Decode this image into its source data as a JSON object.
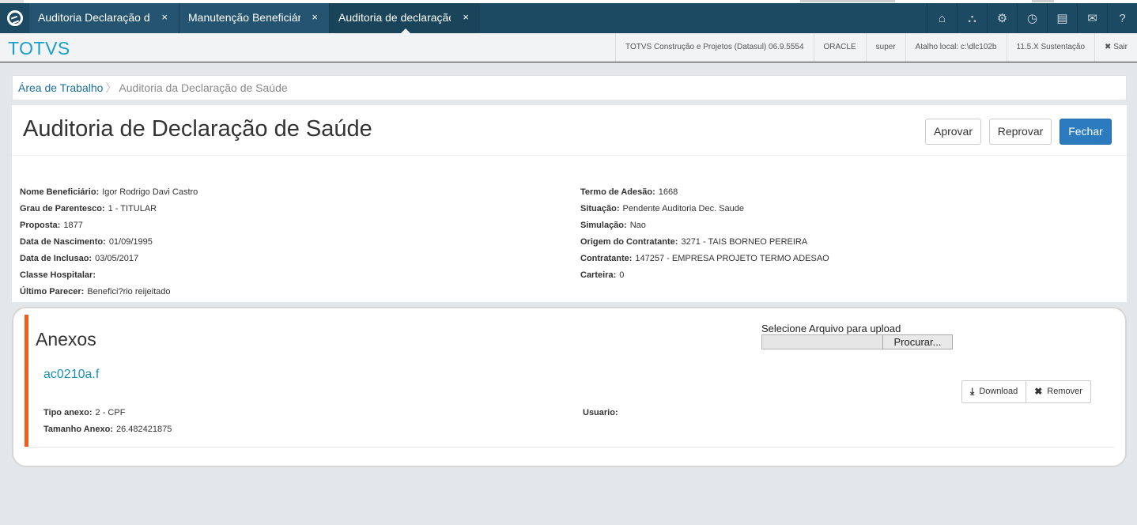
{
  "tabs": [
    {
      "label": "Auditoria Declaração de Saúde",
      "close": "×"
    },
    {
      "label": "Manutenção Beneficiário",
      "close": "×"
    },
    {
      "label": "Auditoria de declaração",
      "close": "×"
    }
  ],
  "topicons": [
    "home-icon",
    "sitemap-icon",
    "gear-icon",
    "clock-icon",
    "document-icon",
    "mail-icon",
    "help-icon"
  ],
  "topicon_glyphs": [
    "⌂",
    "⛬",
    "⚙",
    "◷",
    "▤",
    "✉",
    "?"
  ],
  "header": {
    "brand": "TOTVS",
    "company": "TOTVS Construção e Projetos (Datasul) 06.9.5554",
    "db": "ORACLE",
    "user": "super",
    "shortcut": "Atalho local: c:\\dlc102b",
    "version": "11.5.X Sustentação",
    "logout": "✖ Sair"
  },
  "breadcrumb": {
    "home": "Área de Trabalho",
    "current": "Auditoria da Declaração de Saúde"
  },
  "page": {
    "title": "Auditoria de Declaração de Saúde",
    "approve": "Aprovar",
    "reject": "Reprovar",
    "close": "Fechar"
  },
  "info_left": [
    {
      "label": "Nome Beneficiário:",
      "value": "Igor Rodrigo Davi Castro"
    },
    {
      "label": "Grau de Parentesco:",
      "value": "1 - TITULAR"
    },
    {
      "label": "Proposta:",
      "value": "1877"
    },
    {
      "label": "Data de Nascimento:",
      "value": "01/09/1995"
    },
    {
      "label": "Data de Inclusao:",
      "value": "03/05/2017"
    },
    {
      "label": "Classe Hospitalar:",
      "value": ""
    },
    {
      "label": "Último Parecer:",
      "value": "Benefici?rio reijeitado"
    }
  ],
  "info_right": [
    {
      "label": "Termo de Adesão:",
      "value": "1668"
    },
    {
      "label": "Situação:",
      "value": "Pendente Auditoria Dec. Saude"
    },
    {
      "label": "Simulação:",
      "value": "Nao"
    },
    {
      "label": "Origem do Contratante:",
      "value": "3271 - TAIS BORNEO PEREIRA"
    },
    {
      "label": "Contratante:",
      "value": "147257 - EMPRESA PROJETO TERMO ADESAO"
    },
    {
      "label": "Carteira:",
      "value": "0"
    }
  ],
  "anexos": {
    "title": "Anexos",
    "upload_label": "Selecione Arquivo para upload",
    "browse": "Procurar...",
    "file_name": "ac0210a.f",
    "download": "Download",
    "remove": "Remover",
    "tipo_label": "Tipo anexo:",
    "tipo_value": "2 - CPF",
    "tamanho_label": "Tamanho Anexo:",
    "tamanho_value": "26.482421875",
    "usuario_label": "Usuario:",
    "usuario_value": ""
  }
}
